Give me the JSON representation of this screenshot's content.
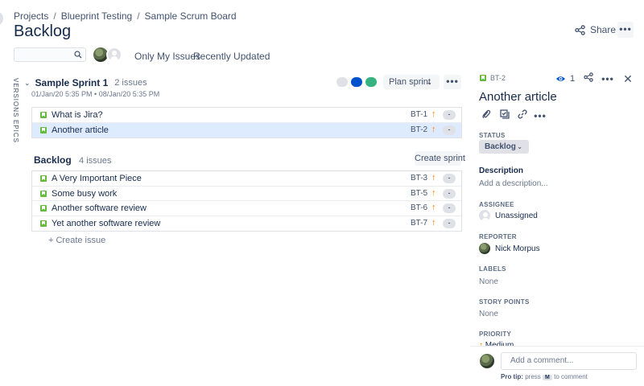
{
  "breadcrumb": {
    "items": [
      "Projects",
      "Blueprint Testing",
      "Sample Scrum Board"
    ],
    "separator": "/"
  },
  "page_title": "Backlog",
  "header": {
    "share_label": "Share",
    "more_label": "•••"
  },
  "search": {
    "value": "",
    "placeholder": ""
  },
  "filters": {
    "my_issues": "Only My Issues",
    "recently_updated": "Recently Updated"
  },
  "side_tabs": {
    "versions": "VERSIONS",
    "epics": "EPICS"
  },
  "sprint": {
    "chevron": "⌄",
    "name": "Sample Sprint 1",
    "count": "2 issues",
    "dates": "01/Jan/20 5:35 PM  •  08/Jan/20 5:35 PM",
    "status_dots": [
      "#dfe1e6",
      "#0052cc",
      "#36b37e"
    ],
    "plan_label": "Plan sprint",
    "caret": "⌄",
    "more_label": "•••",
    "issues": [
      {
        "summary": "What is Jira?",
        "key": "BT-1",
        "priority_icon": "↑",
        "estimate": "-"
      },
      {
        "summary": "Another article",
        "key": "BT-2",
        "priority_icon": "↑",
        "estimate": "-"
      }
    ]
  },
  "backlog": {
    "name": "Backlog",
    "count": "4 issues",
    "create_sprint_label": "Create sprint",
    "create_issue_label": "+   Create issue",
    "issues": [
      {
        "summary": "A Very Important Piece",
        "key": "BT-3",
        "priority_icon": "↑",
        "estimate": "-"
      },
      {
        "summary": "Some busy work",
        "key": "BT-5",
        "priority_icon": "↑",
        "estimate": "-"
      },
      {
        "summary": "Another software review",
        "key": "BT-6",
        "priority_icon": "↑",
        "estimate": "-"
      },
      {
        "summary": "Yet another software review",
        "key": "BT-7",
        "priority_icon": "↑",
        "estimate": "-"
      }
    ]
  },
  "detail": {
    "key": "BT-2",
    "watch_count": "1",
    "more_label": "•••",
    "close_label": "✕",
    "title": "Another article",
    "tool_more_label": "•••",
    "status_label": "STATUS",
    "status_value": "Backlog",
    "status_caret": "⌄",
    "description_label": "Description",
    "description_placeholder": "Add a description...",
    "assignee_label": "ASSIGNEE",
    "assignee_value": "Unassigned",
    "reporter_label": "REPORTER",
    "reporter_value": "Nick Morpus",
    "labels_label": "LABELS",
    "labels_value": "None",
    "story_points_label": "STORY POINTS",
    "story_points_value": "None",
    "priority_label": "PRIORITY",
    "priority_value": "Medium",
    "priority_icon": "↑",
    "comment_placeholder": "Add a comment...",
    "pro_tip_label": "Pro tip:",
    "pro_tip_press": "press",
    "pro_tip_key": "M",
    "pro_tip_rest": "to comment"
  },
  "colors": {
    "accent": "#0052cc",
    "selected_row": "#deebff",
    "story": "#63ba3c",
    "priority": "#ff7a00"
  }
}
